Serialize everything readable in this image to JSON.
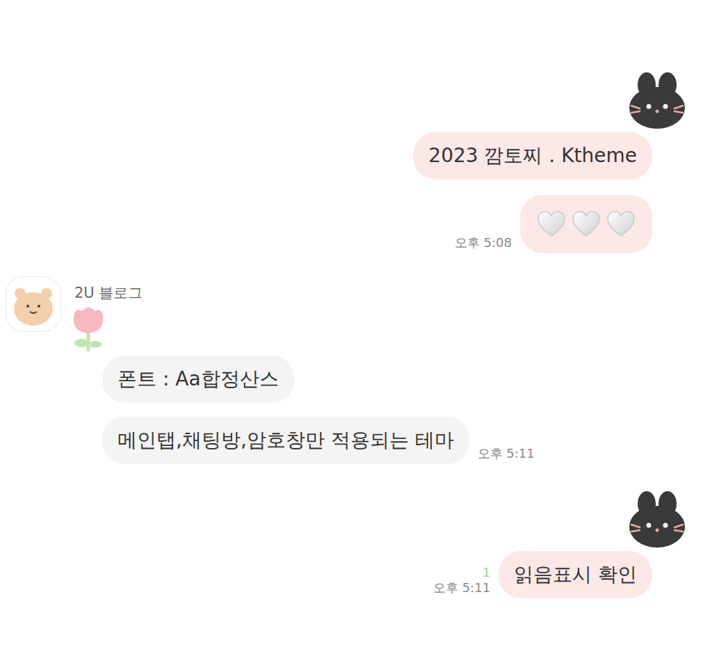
{
  "chat": {
    "groups": [
      {
        "side": "me",
        "messages": [
          {
            "kind": "text",
            "text": "2023 깜토찌 . Ktheme"
          },
          {
            "kind": "hearts",
            "count": 3,
            "time": "오후 5:08"
          }
        ]
      },
      {
        "side": "other",
        "sender": "2U 블로그",
        "messages": [
          {
            "kind": "sticker"
          },
          {
            "kind": "text",
            "text": "폰트 : Aa합정산스"
          },
          {
            "kind": "text",
            "text": "메인탭,채팅방,암호창만 적용되는 테마",
            "time": "오후 5:11"
          }
        ]
      },
      {
        "side": "me",
        "messages": [
          {
            "kind": "text",
            "text": "읽음표시 확인",
            "time": "오후 5:11",
            "unread": "1"
          }
        ]
      }
    ]
  }
}
